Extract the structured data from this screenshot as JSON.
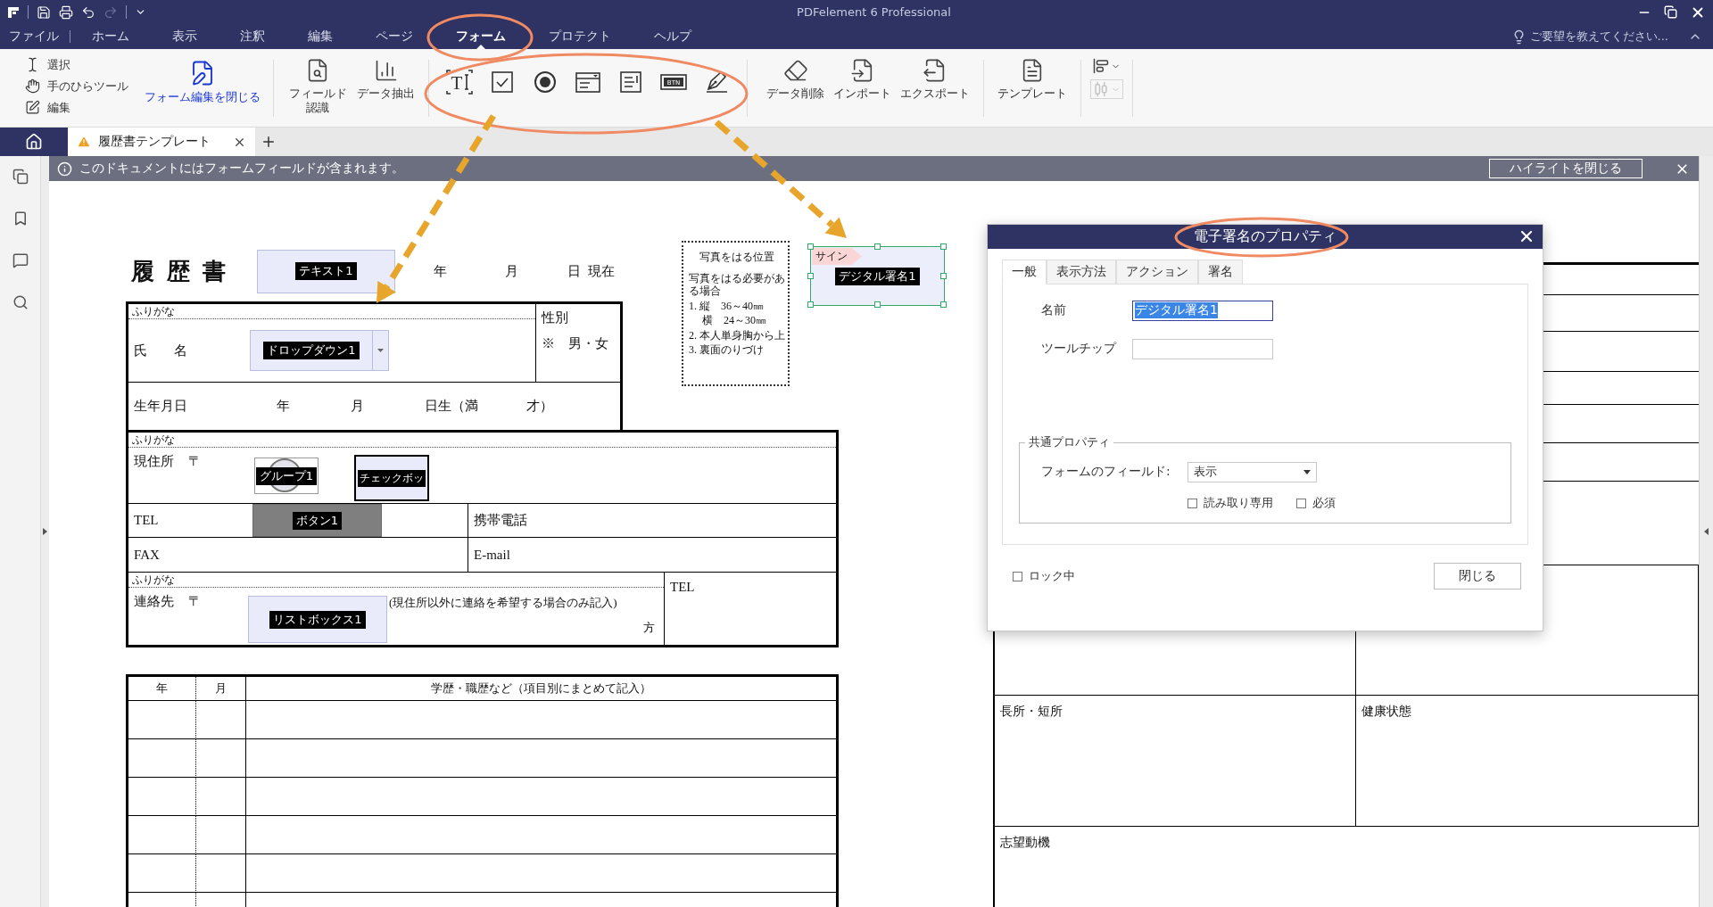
{
  "window": {
    "title": "PDFelement 6 Professional"
  },
  "quick_access": [
    {
      "kind": "save",
      "disabled": false
    },
    {
      "kind": "print",
      "disabled": false
    },
    {
      "kind": "undo",
      "disabled": false
    },
    {
      "kind": "redo",
      "disabled": true
    }
  ],
  "menu": [
    {
      "label": "ファイル",
      "selected": false
    },
    {
      "label": "ホーム",
      "selected": false
    },
    {
      "label": "表示",
      "selected": false
    },
    {
      "label": "注釈",
      "selected": false
    },
    {
      "label": "編集",
      "selected": false
    },
    {
      "label": "ページ",
      "selected": false
    },
    {
      "label": "フォーム",
      "selected": true
    },
    {
      "label": "プロテクト",
      "selected": false
    },
    {
      "label": "ヘルプ",
      "selected": false
    }
  ],
  "tell_me": "ご要望を教えてください...",
  "ribbon": {
    "modes": [
      {
        "kind": "select",
        "label": "選択"
      },
      {
        "kind": "hand",
        "label": "手のひらツール"
      },
      {
        "kind": "edit",
        "label": "編集"
      }
    ],
    "close_form_edit": "フォーム編集を閉じる",
    "data_tools": [
      {
        "kind": "recognize",
        "label": "フィールド認識"
      },
      {
        "kind": "extract",
        "label": "データ抽出"
      }
    ],
    "field_tools": [
      {
        "kind": "text",
        "glyph": "T"
      },
      {
        "kind": "checkbox"
      },
      {
        "kind": "radio"
      },
      {
        "kind": "combo"
      },
      {
        "kind": "list"
      },
      {
        "kind": "button",
        "glyph": "BTN"
      },
      {
        "kind": "signature"
      }
    ],
    "io_tools": [
      {
        "kind": "clear",
        "label": "データ削除"
      },
      {
        "kind": "import",
        "label": "インポート"
      },
      {
        "kind": "export",
        "label": "エクスポート"
      }
    ],
    "template": {
      "label": "テンプレート"
    },
    "arrange_tools": [
      {
        "kind": "align",
        "disabled": false
      },
      {
        "kind": "distribute",
        "disabled": true
      }
    ]
  },
  "tabs": [
    {
      "kind": "home",
      "selected": false
    },
    {
      "kind": "document",
      "title": "履歴書テンプレート",
      "selected": true
    }
  ],
  "notice": {
    "message": "このドキュメントにはフォームフィールドが含まれます。",
    "button": "ハイライトを閉じる"
  },
  "resume": {
    "title": "履歴書",
    "title_field": "テキスト1",
    "date": [
      "年",
      "月",
      "日",
      "現在"
    ],
    "name_row": {
      "furigana": "ふりがな",
      "label": "氏名",
      "field": "ドロップダウン1",
      "gender_label": "性別",
      "gender_value": "※　男・女"
    },
    "birth_row": [
      "生年月日",
      "年",
      "月",
      "日生（満",
      "才）"
    ],
    "address_row": {
      "furigana": "ふりがな",
      "label": "現住所",
      "postal": "〒",
      "radio_field": "グループ1",
      "checkbox_field": "チェックボッ"
    },
    "tel_row": {
      "label": "TEL",
      "button_field": "ボタン1",
      "mobile": "携帯電話"
    },
    "fax_row": {
      "label": "FAX",
      "email": "E-mail"
    },
    "contact_row": {
      "furigana": "ふりがな",
      "label": "連絡先",
      "postal": "〒",
      "list_field": "リストボックス1",
      "note": "(現住所以外に連絡を希望する場合のみ記入)",
      "suffix": "方",
      "tel": "TEL"
    },
    "photo_box": {
      "title": "写真をはる位置",
      "lines": [
        "写真をはる必要がある場合",
        "1. 縦　36～40㎜",
        "　 横　24～30㎜",
        "2. 本人単身胸から上",
        "3. 裏面のりづけ"
      ]
    },
    "signature_field": {
      "tag": "サイン",
      "label": "デジタル署名1",
      "selected": true
    },
    "history": {
      "columns": [
        "年",
        "月",
        "学歴・職歴など（項目別にまとめて記入）"
      ]
    },
    "right_table": {
      "strengths": "長所・短所",
      "health": "健康状態",
      "motivation": "志望動機"
    }
  },
  "dialog": {
    "title": "電子署名のプロパティ",
    "tabs": [
      {
        "label": "一般",
        "selected": true
      },
      {
        "label": "表示方法",
        "selected": false
      },
      {
        "label": "アクション",
        "selected": false
      },
      {
        "label": "署名",
        "selected": false
      }
    ],
    "name": {
      "label": "名前",
      "value": "デジタル署名1",
      "highlighted": true
    },
    "tooltip": {
      "label": "ツールチップ"
    },
    "common": {
      "legend": "共通プロパティ",
      "visibility_label": "フォームのフィールド:",
      "visibility_value": "表示",
      "read_only": {
        "label": "読み取り専用",
        "checked": false
      },
      "required": {
        "label": "必須",
        "checked": false
      }
    },
    "locked": {
      "label": "ロック中",
      "checked": false
    },
    "close_button": "閉じる"
  }
}
